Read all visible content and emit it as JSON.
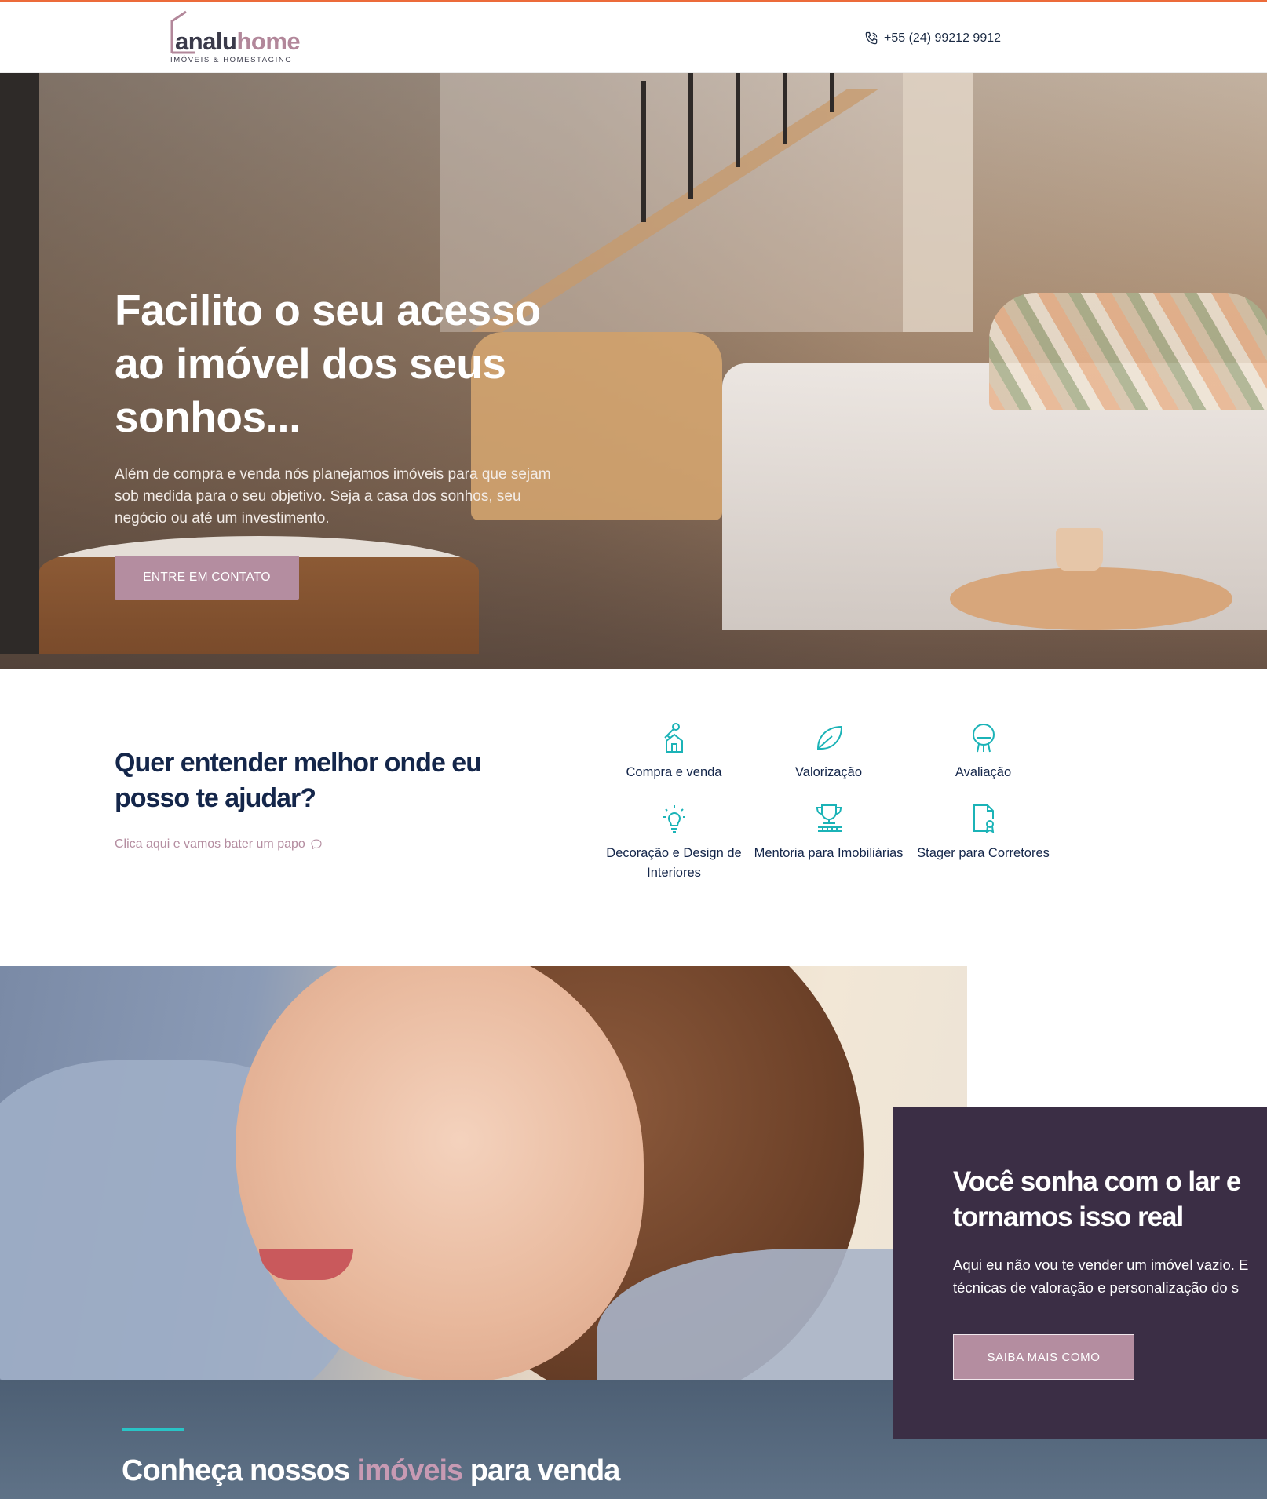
{
  "header": {
    "logo": {
      "part1": "analu",
      "part2": "home",
      "tagline": "IMÓVEIS & HOMESTAGING"
    },
    "phone": {
      "icon": "phone-icon",
      "number": "+55 (24) 99212 9912"
    }
  },
  "hero": {
    "title": "Facilito o seu acesso ao imóvel dos seus sonhos...",
    "text": "Além de compra e venda nós planejamos imóveis para que sejam sob medida para o seu objetivo. Seja a casa dos sonhos, seu negócio ou até um investimento.",
    "cta_label": "ENTRE EM CONTATO"
  },
  "help": {
    "title": "Quer entender melhor onde eu posso te ajudar?",
    "link": "Clica aqui e vamos bater um papo",
    "link_icon": "chat-bubble-icon"
  },
  "services": [
    {
      "label": "Compra e venda",
      "icon": "house-key-icon"
    },
    {
      "label": "Valorização",
      "icon": "leaf-icon"
    },
    {
      "label": "Avaliação",
      "icon": "chair-icon"
    },
    {
      "label": "Decoração e Design de Interiores",
      "icon": "lightbulb-icon"
    },
    {
      "label": "Mentoria para Imobiliárias",
      "icon": "trophy-icon"
    },
    {
      "label": "Stager para Corretores",
      "icon": "certificate-icon"
    }
  ],
  "dream": {
    "title": "Você sonha com o lar e tornamos isso real",
    "text_line1": "Aqui eu não vou te vender um imóvel vazio. E",
    "text_line2": "técnicas de valoração e personalização do s",
    "cta_label": "SAIBA MAIS COMO"
  },
  "properties": {
    "title_part1": "Conheça nossos ",
    "title_highlight": "imóveis",
    "title_part2": " para venda"
  },
  "colors": {
    "accent_top": "#ec6b3a",
    "brand_pink": "#b48da0",
    "teal_icons": "#1bb3b7",
    "navy_text": "#14264a",
    "card_purple": "#3b2e45"
  }
}
